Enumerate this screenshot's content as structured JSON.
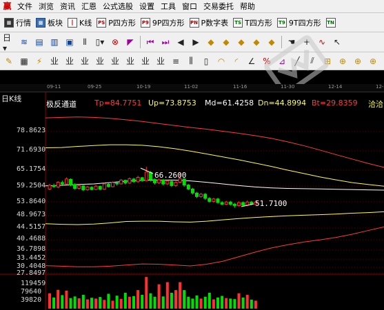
{
  "menu": {
    "logo_glyph": "赢",
    "items": [
      "文件",
      "浏览",
      "资讯",
      "汇恩",
      "公式选股",
      "设置",
      "工具",
      "窗口",
      "交易委托",
      "帮助"
    ]
  },
  "period_toolbar": [
    {
      "label": "行情",
      "icon": "grid-icon"
    },
    {
      "label": "板块",
      "icon": "blocks-icon"
    },
    {
      "label": "K线",
      "icon": "kline-icon"
    },
    {
      "label": "P四方形",
      "icon_text": "PS"
    },
    {
      "label": "9P四方形",
      "icon_text": "P9"
    },
    {
      "label": "P数字表",
      "icon_text": "PN"
    },
    {
      "label": "T四方形",
      "icon_text": "TS"
    },
    {
      "label": "9T四方形",
      "icon_text": "T9"
    },
    {
      "label": "",
      "icon_text": "TN"
    }
  ],
  "chart": {
    "period_label": "日K线",
    "indicator": {
      "name": "极反通道",
      "tp": "Tp=84.7751",
      "up": "Up=73.8753",
      "md": "Md=61.4258",
      "dn": "Dn=44.8994",
      "bt": "Bt=29.8359"
    },
    "corner_label": "洽洽",
    "dates": [
      "09-11",
      "09-25",
      "10-19",
      "11-02",
      "11-16",
      "11-30",
      "12-14",
      "12-"
    ],
    "price_labels": [
      "78.8623",
      "71.6930",
      "65.1754",
      "59.2504",
      "53.8640",
      "48.9673",
      "44.5157",
      "40.4688",
      "36.7898",
      "33.4452",
      "30.4048",
      "27.8497"
    ],
    "volume_labels": [
      "119459",
      "79640",
      "39820"
    ],
    "high_annotation": "66.2600",
    "low_annotation": "51.7100",
    "colors": {
      "tp": "#ff3b3b",
      "up": "#ffff44",
      "md": "#ffffff",
      "dn": "#ffff44",
      "bt": "#ff3b3b",
      "rise": "#ff3030",
      "fall": "#00e000"
    }
  },
  "chart_data": {
    "type": "candlestick",
    "y_axis": "price",
    "ylim": [
      27.85,
      90
    ],
    "series": [
      {
        "name": "Tp",
        "values": [
          84.4,
          84.6,
          84.8,
          84.6,
          84.2,
          83.6,
          82.9,
          82.1,
          81.3,
          80.5,
          79.8,
          79.0,
          78.2,
          77.3,
          76.3,
          75.0,
          73.6,
          72.0,
          70.4,
          68.9,
          67.4,
          66.1
        ]
      },
      {
        "name": "Up",
        "values": [
          72.8,
          72.9,
          73.3,
          73.6,
          73.9,
          73.9,
          73.7,
          73.2,
          72.5,
          71.6,
          70.6,
          69.6,
          68.6,
          67.5,
          66.4,
          65.2,
          63.9,
          62.6,
          61.5,
          60.5,
          59.8,
          59.2
        ]
      },
      {
        "name": "Md",
        "values": [
          59.3,
          59.5,
          59.8,
          60.0,
          60.5,
          61.0,
          61.3,
          61.4,
          61.4,
          61.1,
          60.6,
          60.0,
          59.4,
          58.9,
          58.6,
          58.4,
          58.3,
          58.2,
          58.1,
          58.0,
          57.9,
          57.8
        ]
      },
      {
        "name": "Dn",
        "values": [
          46.0,
          45.8,
          45.7,
          45.9,
          46.3,
          46.8,
          46.9,
          46.9,
          46.7,
          46.6,
          46.9,
          47.4,
          47.9,
          48.3,
          48.6,
          48.9,
          49.1,
          49.3,
          49.5,
          49.8,
          50.0,
          50.3
        ]
      },
      {
        "name": "Bt",
        "values": [
          31.0,
          30.8,
          30.6,
          30.6,
          30.8,
          31.2,
          31.6,
          31.5,
          31.2,
          30.9,
          31.5,
          32.6,
          34.3,
          36.0,
          37.5,
          38.6,
          39.6,
          40.4,
          41.2,
          42.3,
          43.6,
          44.9
        ]
      }
    ],
    "candles": [
      [
        58.2,
        59.5,
        57.8,
        60.0
      ],
      [
        59.4,
        59.0,
        58.6,
        60.1
      ],
      [
        58.9,
        60.6,
        58.5,
        61.0
      ],
      [
        60.5,
        60.0,
        59.6,
        61.2
      ],
      [
        60.0,
        61.8,
        59.8,
        62.4
      ],
      [
        61.7,
        59.6,
        59.2,
        62.0
      ],
      [
        59.7,
        58.4,
        58.0,
        60.2
      ],
      [
        58.4,
        59.4,
        58.0,
        59.8
      ],
      [
        59.3,
        57.9,
        57.5,
        59.6
      ],
      [
        57.9,
        58.9,
        57.6,
        59.3
      ],
      [
        58.8,
        58.0,
        57.7,
        59.2
      ],
      [
        58.0,
        59.2,
        57.8,
        59.6
      ],
      [
        59.1,
        58.1,
        57.8,
        59.4
      ],
      [
        58.1,
        60.0,
        57.9,
        60.4
      ],
      [
        59.9,
        59.0,
        58.7,
        60.3
      ],
      [
        59.0,
        60.5,
        58.8,
        60.9
      ],
      [
        60.4,
        60.0,
        59.4,
        61.0
      ],
      [
        60.0,
        61.4,
        59.8,
        61.8
      ],
      [
        61.3,
        60.3,
        59.8,
        61.6
      ],
      [
        60.3,
        61.9,
        60.0,
        62.4
      ],
      [
        61.8,
        60.8,
        60.4,
        62.2
      ],
      [
        60.8,
        62.4,
        60.5,
        63.0
      ],
      [
        62.3,
        61.2,
        60.8,
        62.6
      ],
      [
        61.2,
        64.4,
        61.0,
        66.26
      ],
      [
        64.3,
        61.6,
        60.9,
        64.8
      ],
      [
        61.6,
        60.4,
        59.8,
        62.0
      ],
      [
        60.4,
        61.5,
        60.0,
        62.0
      ],
      [
        61.4,
        60.0,
        59.5,
        61.8
      ],
      [
        60.0,
        61.0,
        59.6,
        61.4
      ],
      [
        60.9,
        59.4,
        58.9,
        61.2
      ],
      [
        59.4,
        60.6,
        59.0,
        61.0
      ],
      [
        60.6,
        61.9,
        60.2,
        64.0
      ],
      [
        61.8,
        59.6,
        59.0,
        62.2
      ],
      [
        59.6,
        58.2,
        57.8,
        60.0
      ],
      [
        58.2,
        56.8,
        56.3,
        58.6
      ],
      [
        56.8,
        55.6,
        55.1,
        57.2
      ],
      [
        55.6,
        56.4,
        55.2,
        56.9
      ],
      [
        56.4,
        55.0,
        54.5,
        56.8
      ],
      [
        55.0,
        54.0,
        53.6,
        55.4
      ],
      [
        54.0,
        54.8,
        53.6,
        55.2
      ],
      [
        54.8,
        53.6,
        53.2,
        55.2
      ],
      [
        53.6,
        53.0,
        52.6,
        54.1
      ],
      [
        53.0,
        53.8,
        52.7,
        54.2
      ],
      [
        53.8,
        53.0,
        52.5,
        54.2
      ],
      [
        53.0,
        52.5,
        51.71,
        53.5
      ],
      [
        52.5,
        53.6,
        52.2,
        54.0
      ],
      [
        53.6,
        52.6,
        52.2,
        54.0
      ],
      [
        52.6,
        53.8,
        52.3,
        54.3
      ],
      [
        53.8,
        53.0,
        52.6,
        54.2
      ],
      [
        53.0,
        53.8,
        52.8,
        54.2
      ]
    ],
    "volume": [
      58000,
      42000,
      71000,
      51000,
      68000,
      40000,
      46000,
      39000,
      52000,
      35000,
      41000,
      38000,
      44000,
      33000,
      56000,
      30000,
      49000,
      37000,
      60000,
      45000,
      47000,
      70000,
      52000,
      119459,
      58000,
      45000,
      92000,
      46000,
      100000,
      60000,
      70000,
      100000,
      70000,
      45000,
      38000,
      50000,
      38000,
      45000,
      60000,
      35000,
      42000,
      48000,
      40000,
      38000,
      36000,
      58000,
      42000,
      52000,
      34000,
      30000
    ]
  }
}
